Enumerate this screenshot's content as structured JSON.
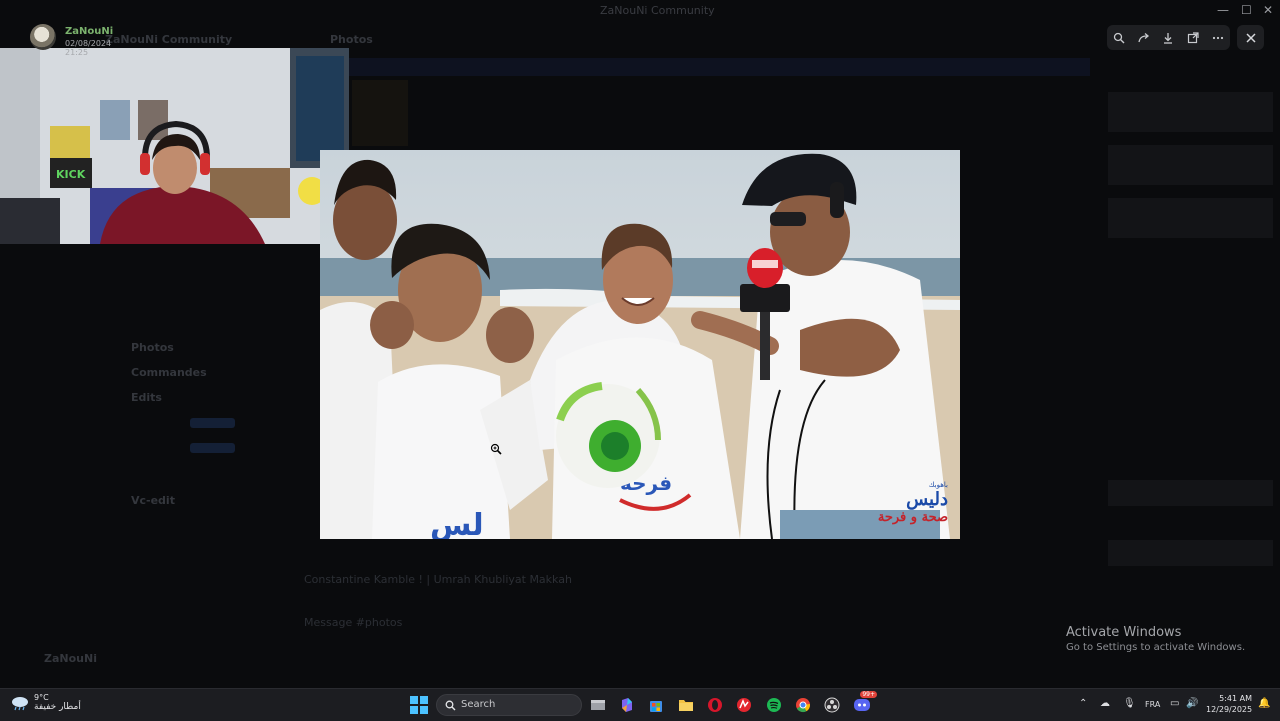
{
  "window": {
    "title": "ZaNouNi Community"
  },
  "background": {
    "server_name": "ZaNouNi Community",
    "channel_name": "Photos",
    "categories": [
      "Photos",
      "Commandes",
      "Edits",
      "Vc-edit"
    ],
    "message_text": "Constantine Kamble ! | Umrah Khubliyat Makkah",
    "input_placeholder": "Message #photos",
    "user_name": "ZaNouNi"
  },
  "streamer": {
    "name": "ZaNouNi",
    "date": "02/08/2024 21:25"
  },
  "viewer_toolbar": {
    "icons": [
      "zoom-icon",
      "forward-icon",
      "download-icon",
      "open-external-icon",
      "more-icon"
    ],
    "close_icon": "close-icon"
  },
  "media": {
    "logo_small": "باهوبك",
    "logo_big": "دليس",
    "logo_sub": "صحة و فرحة",
    "shirt_text": "صحتو فرحة"
  },
  "activation": {
    "title": "Activate Windows",
    "subtitle": "Go to Settings to activate Windows."
  },
  "taskbar": {
    "weather_temp": "9°C",
    "weather_desc": "أمطار خفيفة",
    "search_label": "Search",
    "language": "FRA",
    "time": "5:41 AM",
    "date": "12/29/2025",
    "discord_badge": "99+",
    "apps": [
      "file-explorer-icon",
      "copilot-icon",
      "store-icon",
      "folder-icon",
      "opera-icon",
      "app-red-icon",
      "spotify-icon",
      "chrome-icon",
      "obs-icon",
      "discord-icon"
    ]
  },
  "colors": {
    "accent": "#4cc2ff",
    "discord": "#5865f2",
    "spotify": "#1db954"
  }
}
